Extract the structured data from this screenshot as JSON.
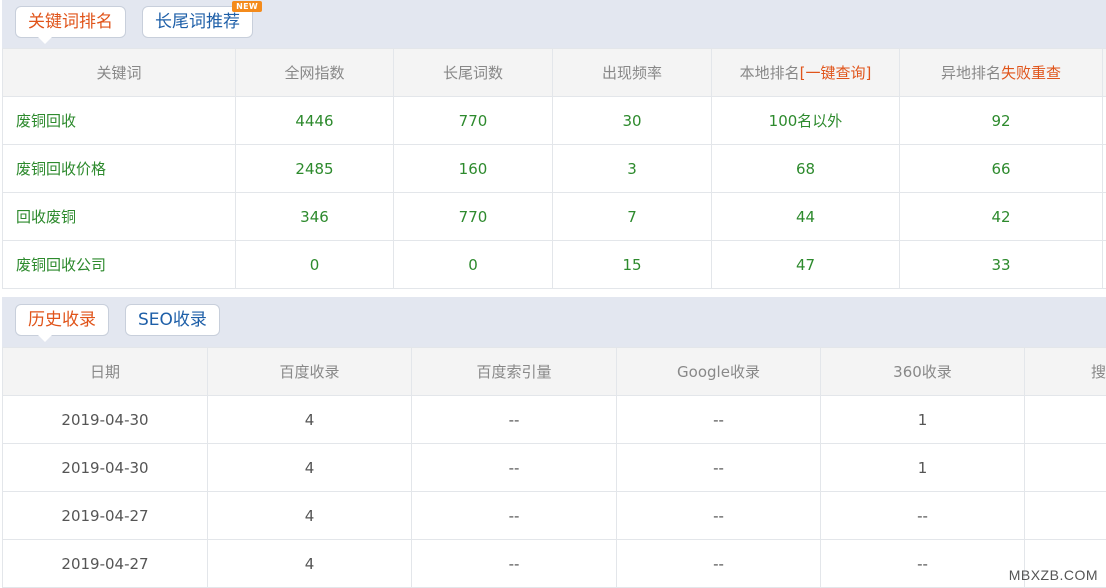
{
  "top_tabs": {
    "ranking": "关键词排名",
    "longtail": "长尾词推荐",
    "badge": "NEW"
  },
  "keyword_table": {
    "headers": {
      "keyword": "关键词",
      "net_index": "全网指数",
      "longtail_count": "长尾词数",
      "frequency": "出现频率",
      "local_rank": "本地排名",
      "local_rank_link": "[一键查询]",
      "remote_rank": "异地排名",
      "remote_rank_link": "失败重查"
    },
    "rows": [
      {
        "keyword": "废铜回收",
        "net_index": "4446",
        "longtail_count": "770",
        "frequency": "30",
        "local_rank": "100名以外",
        "remote_rank": "92"
      },
      {
        "keyword": "废铜回收价格",
        "net_index": "2485",
        "longtail_count": "160",
        "frequency": "3",
        "local_rank": "68",
        "remote_rank": "66"
      },
      {
        "keyword": "回收废铜",
        "net_index": "346",
        "longtail_count": "770",
        "frequency": "7",
        "local_rank": "44",
        "remote_rank": "42"
      },
      {
        "keyword": "废铜回收公司",
        "net_index": "0",
        "longtail_count": "0",
        "frequency": "15",
        "local_rank": "47",
        "remote_rank": "33"
      }
    ]
  },
  "bottom_tabs": {
    "history": "历史收录",
    "seo": "SEO收录"
  },
  "index_table": {
    "headers": {
      "date": "日期",
      "baidu": "百度收录",
      "baidu_index": "百度索引量",
      "google": "Google收录",
      "so360": "360收录",
      "extra": "搜"
    },
    "rows": [
      {
        "date": "2019-04-30",
        "baidu": "4",
        "baidu_index": "--",
        "google": "--",
        "so360": "1"
      },
      {
        "date": "2019-04-30",
        "baidu": "4",
        "baidu_index": "--",
        "google": "--",
        "so360": "1"
      },
      {
        "date": "2019-04-27",
        "baidu": "4",
        "baidu_index": "--",
        "google": "--",
        "so360": "--"
      },
      {
        "date": "2019-04-27",
        "baidu": "4",
        "baidu_index": "--",
        "google": "--",
        "so360": "--"
      }
    ]
  },
  "watermark": "MBXZB.COM"
}
